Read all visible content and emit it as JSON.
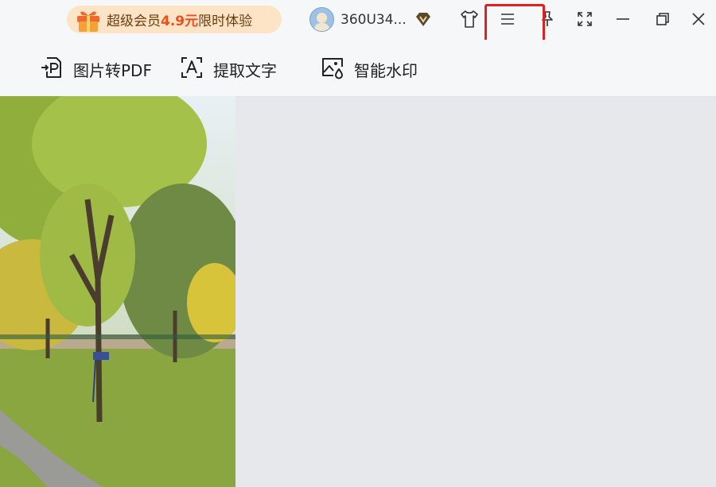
{
  "top_bar": {
    "vip_promo": {
      "prefix": "超级会员",
      "price": "4.9元",
      "suffix": "限时体验"
    },
    "user": {
      "name": "360U34..."
    },
    "window_controls": [
      "skin-icon",
      "menu-icon",
      "pin-icon",
      "fullscreen-icon",
      "minimize-icon",
      "restore-icon",
      "close-icon"
    ]
  },
  "toolbar": {
    "items": [
      {
        "label": "图片转PDF",
        "icon": "image-to-pdf-icon"
      },
      {
        "label": "提取文字",
        "icon": "extract-text-icon"
      },
      {
        "label": "智能水印",
        "icon": "smart-watermark-icon"
      }
    ]
  },
  "colors": {
    "accent_price": "#e8511e",
    "promo_bg": "#fde4c6",
    "highlight_box": "#e02020",
    "canvas_bg": "#e6e8eb"
  }
}
